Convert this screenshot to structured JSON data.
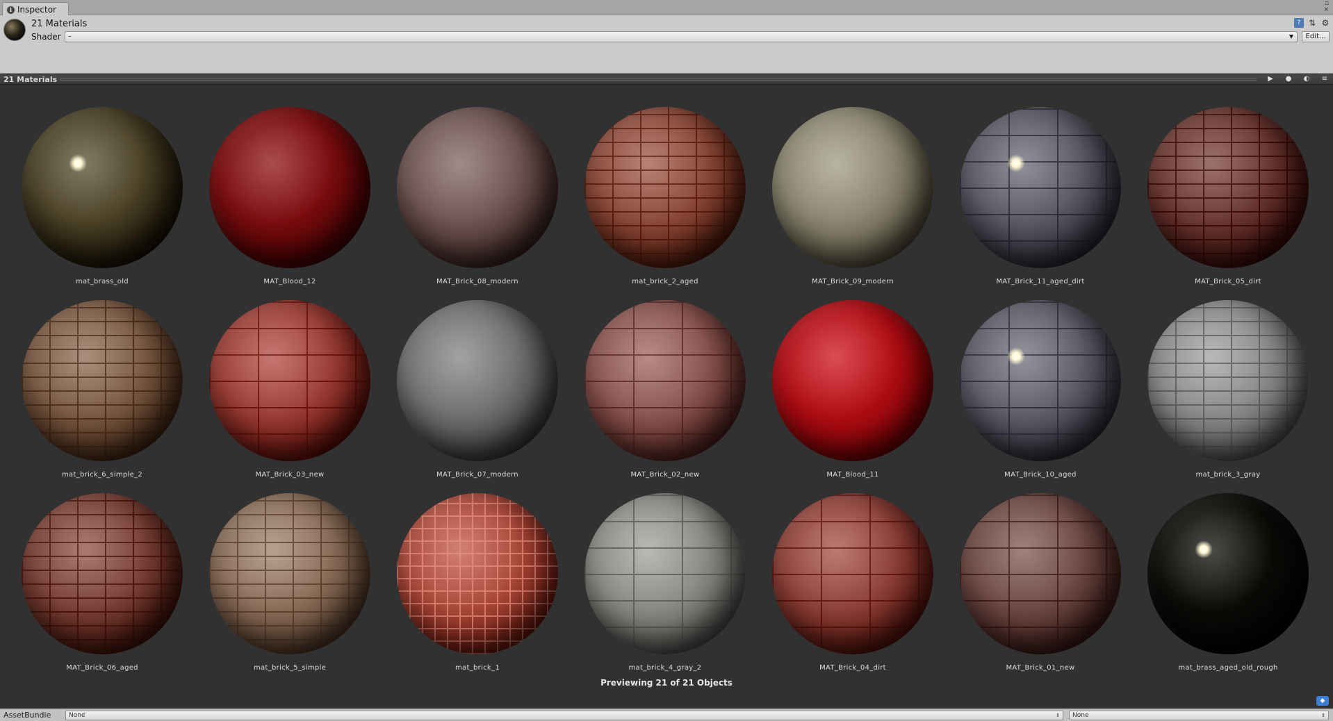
{
  "tab": {
    "label": "Inspector"
  },
  "header": {
    "title": "21 Materials",
    "shader_label": "Shader",
    "shader_value": "–",
    "edit_label": "Edit..."
  },
  "preview": {
    "title": "21 Materials",
    "status": "Previewing 21 of 21 Objects"
  },
  "materials": [
    {
      "name": "mat_brass_old",
      "color": "#4a4126",
      "pattern": "none",
      "highlight": true
    },
    {
      "name": "MAT_Blood_12",
      "color": "#7a0c0e",
      "pattern": "none"
    },
    {
      "name": "MAT_Brick_08_modern",
      "color": "#6e5552",
      "pattern": "none"
    },
    {
      "name": "mat_brick_2_aged",
      "color": "#8a4a3a",
      "pattern": "brick"
    },
    {
      "name": "MAT_Brick_09_modern",
      "color": "#8a8570",
      "pattern": "none"
    },
    {
      "name": "MAT_Brick_11_aged_dirt",
      "color": "#5a5a66",
      "pattern": "brick-large",
      "highlight": true
    },
    {
      "name": "MAT_Brick_05_dirt",
      "color": "#6a3832",
      "pattern": "brick"
    },
    {
      "name": "mat_brick_6_simple_2",
      "color": "#7a5a44",
      "pattern": "brick"
    },
    {
      "name": "MAT_Brick_03_new",
      "color": "#9a3e36",
      "pattern": "brick-large"
    },
    {
      "name": "MAT_Brick_07_modern",
      "color": "#707070",
      "pattern": "none"
    },
    {
      "name": "MAT_Brick_02_new",
      "color": "#8a5550",
      "pattern": "brick-large"
    },
    {
      "name": "MAT_Blood_11",
      "color": "#b00d14",
      "pattern": "none"
    },
    {
      "name": "MAT_Brick_10_aged",
      "color": "#5e5e6a",
      "pattern": "brick-large",
      "highlight": true
    },
    {
      "name": "mat_brick_3_gray",
      "color": "#8a8a88",
      "pattern": "brick"
    },
    {
      "name": "MAT_Brick_06_aged",
      "color": "#7a4238",
      "pattern": "brick"
    },
    {
      "name": "mat_brick_5_simple",
      "color": "#8a6e5a",
      "pattern": "brick"
    },
    {
      "name": "mat_brick_1",
      "color": "#a8483a",
      "pattern": "tile"
    },
    {
      "name": "mat_brick_4_gray_2",
      "color": "#8a8a86",
      "pattern": "brick-large"
    },
    {
      "name": "MAT_Brick_04_dirt",
      "color": "#8e423a",
      "pattern": "brick-large"
    },
    {
      "name": "MAT_Brick_01_new",
      "color": "#6e4a46",
      "pattern": "brick-large"
    },
    {
      "name": "mat_brass_aged_old_rough",
      "color": "#0c0b08",
      "pattern": "none",
      "highlight": true
    }
  ],
  "assetbundle": {
    "label": "AssetBundle",
    "bundle_value": "None",
    "variant_value": "None"
  }
}
